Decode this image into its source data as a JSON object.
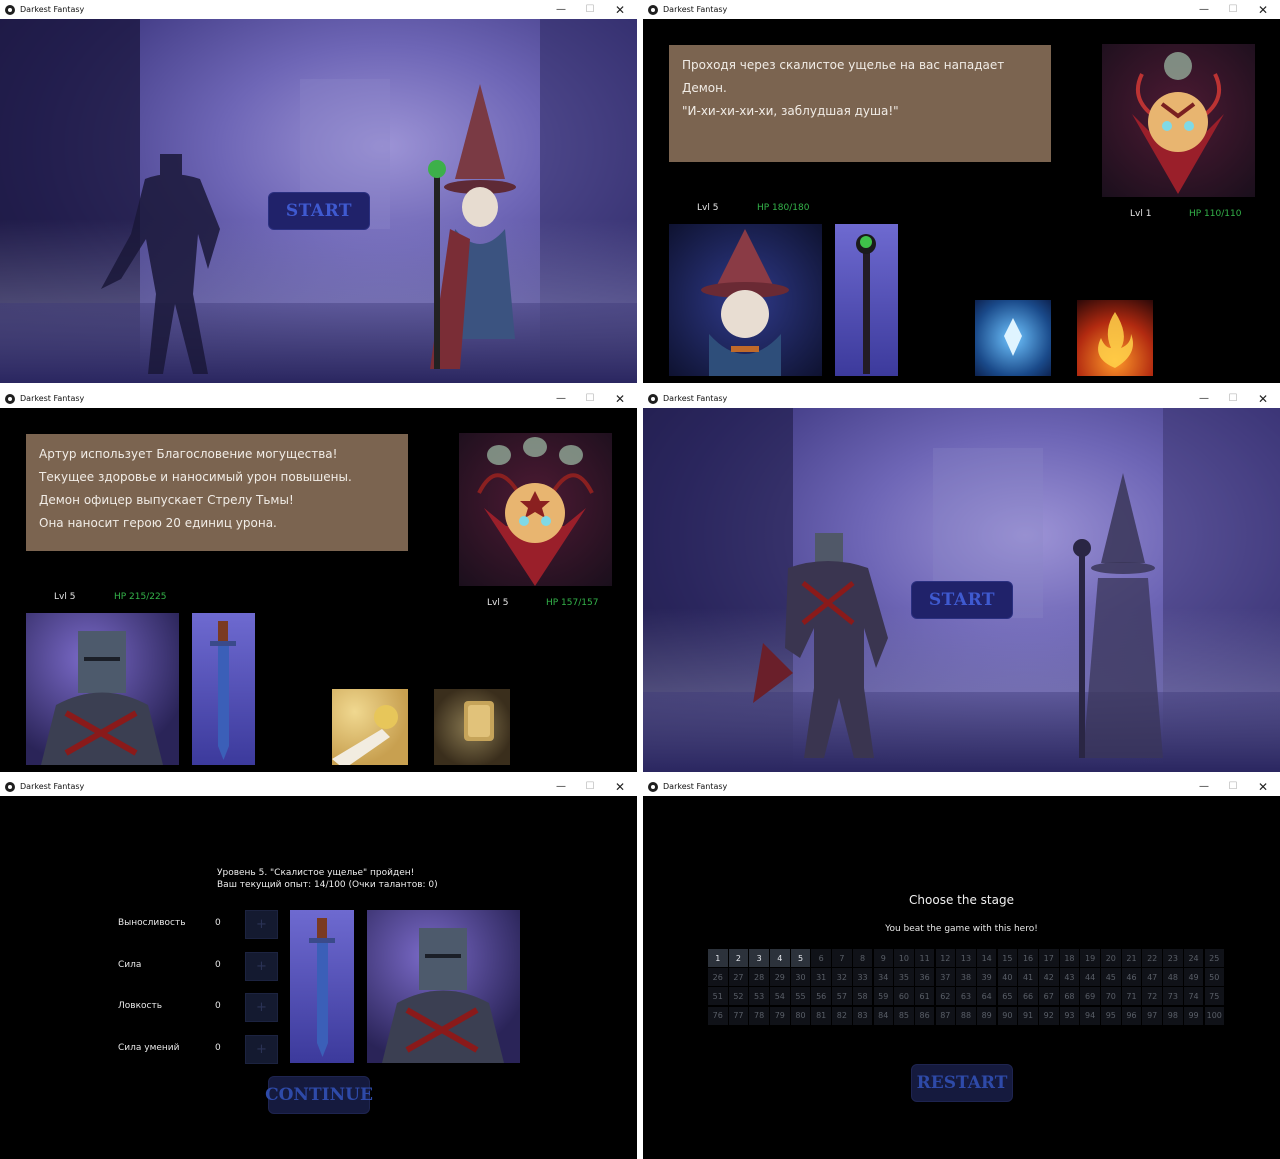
{
  "app": {
    "title": "Darkest Fantasy"
  },
  "windows": {
    "w1": {
      "start_label": "START"
    },
    "w2": {
      "text_lines": [
        "Проходя через скалистое ущелье на вас нападает Демон.",
        "\"И-хи-хи-хи-хи, заблудшая душа!\""
      ],
      "hero": {
        "lvl": "Lvl 5",
        "hp": "HP 180/180"
      },
      "enemy": {
        "lvl": "Lvl 1",
        "hp": "HP 110/110"
      }
    },
    "w3": {
      "text_lines": [
        "Артур использует Благословение могущества!",
        "Текущее здоровье и наносимый урон повышены.",
        "Демон офицер выпускает Стрелу Тьмы!",
        "Она наносит герою 20 единиц урона."
      ],
      "hero": {
        "lvl": "Lvl 5",
        "hp": "HP 215/225"
      },
      "enemy": {
        "lvl": "Lvl 5",
        "hp": "HP 157/157"
      }
    },
    "w4": {
      "start_label": "START"
    },
    "w5": {
      "result_line1": "Уровень 5. \"Скалистое ущелье\" пройден!",
      "result_line2": "Ваш текущий опыт: 14/100 (Очки талантов: 0)",
      "stats": [
        {
          "label": "Выносливость",
          "value": "0"
        },
        {
          "label": "Сила",
          "value": "0"
        },
        {
          "label": "Ловкость",
          "value": "0"
        },
        {
          "label": "Сила умений",
          "value": "0"
        }
      ],
      "plus_label": "+",
      "continue_label": "CONTINUE"
    },
    "w6": {
      "heading": "Choose the stage",
      "subheading": "You beat the game with this hero!",
      "unlocked_count": 5,
      "total_stages": 100,
      "restart_label": "RESTART"
    }
  },
  "colors": {
    "textbox_bg": "#7b6450",
    "hp_green": "#34b34a",
    "button_bg": "#20226a",
    "button_text": "#3f5ad0"
  },
  "icons": [
    "app-icon",
    "minimize-icon",
    "maximize-icon",
    "close-icon"
  ]
}
